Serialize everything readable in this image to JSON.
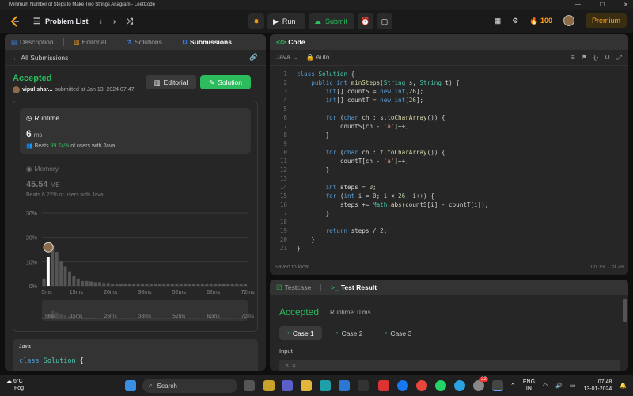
{
  "browser": {
    "title": "Minimum Number of Steps to Make Two Strings Anagram - LeetCode"
  },
  "nav": {
    "problem_list": "Problem List",
    "run": "Run",
    "submit": "Submit",
    "streak": "100",
    "premium": "Premium"
  },
  "left": {
    "tabs": [
      "Description",
      "Editorial",
      "Solutions",
      "Submissions"
    ],
    "all_submissions": "All Submissions",
    "status": "Accepted",
    "user": "vipul shar...",
    "submitted_at": "submitted at Jan 13, 2024 07:47",
    "editorial_btn": "Editorial",
    "solution_btn": "Solution",
    "runtime": {
      "label": "Runtime",
      "value": "6",
      "unit": "ms",
      "beats_prefix": "Beats",
      "beats_pct": "99.74%",
      "beats_suffix": "of users with Java"
    },
    "memory": {
      "label": "Memory",
      "value": "45.54",
      "unit": "MB",
      "beats_prefix": "Beats",
      "beats_pct": "6.22%",
      "beats_suffix": "of users with Java"
    },
    "code_lang": "Java",
    "code_preview": "class Solution {"
  },
  "chart_data": {
    "type": "bar",
    "y_ticks": [
      "30%",
      "20%",
      "10%",
      "0%"
    ],
    "ylim": [
      0,
      30
    ],
    "x_ticks": [
      "5ms",
      "15ms",
      "26ms",
      "38ms",
      "52ms",
      "62ms",
      "72ms"
    ],
    "values": [
      3,
      12,
      17,
      14,
      10,
      8,
      6,
      4,
      3,
      2,
      2,
      1.8,
      1.5,
      1.5,
      1.2,
      1.2,
      1,
      1,
      1,
      1,
      1,
      1,
      1,
      1,
      1,
      1,
      1,
      1,
      1,
      1,
      1,
      1,
      1,
      1,
      1,
      1,
      1,
      1,
      1,
      1,
      1,
      1,
      1,
      1,
      1,
      1,
      1,
      1
    ],
    "highlight_index": 1,
    "grid": true
  },
  "code": {
    "header": "Code",
    "lang": "Java",
    "mode": "Auto",
    "saved": "Saved to local",
    "cursor": "Ln 19, Col 28"
  },
  "test": {
    "tabs": [
      "Testcase",
      "Test Result"
    ],
    "status": "Accepted",
    "runtime": "Runtime: 0 ms",
    "cases": [
      "Case 1",
      "Case 2",
      "Case 3"
    ],
    "input_label": "Input",
    "input_value": "s ="
  },
  "taskbar": {
    "temp": "6°C",
    "weather": "Fog",
    "search": "Search",
    "lang": "ENG",
    "region": "IN",
    "time": "07:48",
    "date": "13-01-2024",
    "badge": "22"
  }
}
